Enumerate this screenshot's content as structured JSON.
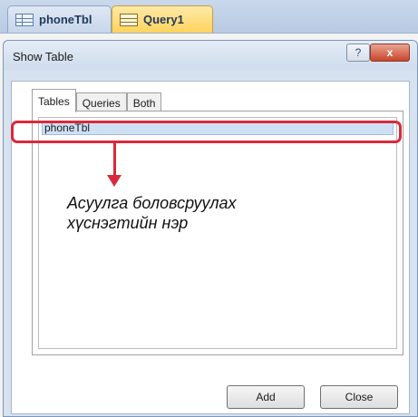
{
  "document_tabs": [
    {
      "label": "phoneTbl",
      "icon": "table-icon"
    },
    {
      "label": "Query1",
      "icon": "query-icon"
    }
  ],
  "dialog": {
    "title": "Show Table",
    "help_label": "?",
    "close_label": "x",
    "tabs": [
      {
        "label": "Tables",
        "active": true
      },
      {
        "label": "Queries",
        "active": false
      },
      {
        "label": "Both",
        "active": false
      }
    ],
    "list_items": [
      {
        "label": "phoneTbl",
        "selected": true
      }
    ],
    "buttons": {
      "add_label": "Add",
      "close_label": "Close"
    }
  },
  "annotation": {
    "line1": "Асуулга боловсруулах",
    "line2": "хүснэгтийн нэр",
    "color": "#d9293a"
  }
}
